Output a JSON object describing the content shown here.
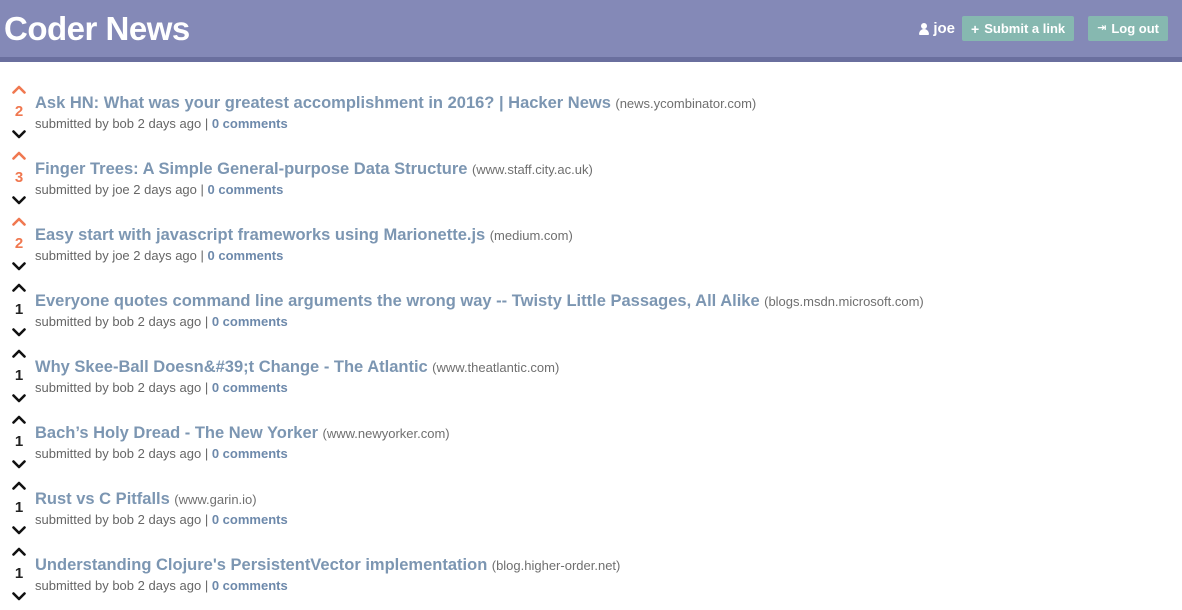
{
  "header": {
    "brand": "Coder News",
    "username": "joe",
    "submit_label": "Submit a link",
    "logout_label": "Log out"
  },
  "colors": {
    "header_bg": "#8489b7",
    "button_bg": "#86b8b0",
    "voted_arrow": "#f07850",
    "title_link": "#7c96b2"
  },
  "posts": [
    {
      "score": "2",
      "title": "Ask HN: What was your greatest accomplishment in 2016? | Hacker News",
      "domain": "(news.ycombinator.com)",
      "meta": "submitted by bob 2 days ago |",
      "comments": "0 comments",
      "voted": true
    },
    {
      "score": "3",
      "title": "Finger Trees: A Simple General-purpose Data Structure",
      "domain": "(www.staff.city.ac.uk)",
      "meta": "submitted by joe 2 days ago |",
      "comments": "0 comments",
      "voted": true
    },
    {
      "score": "2",
      "title": "Easy start with javascript frameworks using Marionette.js",
      "domain": "(medium.com)",
      "meta": "submitted by joe 2 days ago |",
      "comments": "0 comments",
      "voted": true
    },
    {
      "score": "1",
      "title": "Everyone quotes command line arguments the wrong way -- Twisty Little Passages, All Alike",
      "domain": "(blogs.msdn.microsoft.com)",
      "meta": "submitted by bob 2 days ago |",
      "comments": "0 comments",
      "voted": false
    },
    {
      "score": "1",
      "title": "Why Skee-Ball Doesn&#39;t Change - The Atlantic",
      "domain": "(www.theatlantic.com)",
      "meta": "submitted by bob 2 days ago |",
      "comments": "0 comments",
      "voted": false
    },
    {
      "score": "1",
      "title": "Bach’s Holy Dread - The New Yorker",
      "domain": "(www.newyorker.com)",
      "meta": "submitted by bob 2 days ago |",
      "comments": "0 comments",
      "voted": false
    },
    {
      "score": "1",
      "title": "Rust vs C Pitfalls",
      "domain": "(www.garin.io)",
      "meta": "submitted by bob 2 days ago |",
      "comments": "0 comments",
      "voted": false
    },
    {
      "score": "1",
      "title": "Understanding Clojure's PersistentVector implementation",
      "domain": "(blog.higher-order.net)",
      "meta": "submitted by bob 2 days ago |",
      "comments": "0 comments",
      "voted": false
    }
  ]
}
